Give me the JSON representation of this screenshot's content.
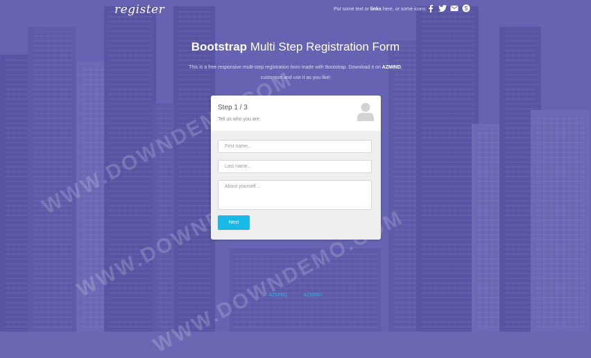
{
  "brand": {
    "logo": "register"
  },
  "topbar": {
    "note_prefix": "Put some text or",
    "note_link": "links",
    "note_suffix": "here, or some icons:",
    "icons": [
      "facebook-icon",
      "twitter-icon",
      "email-icon",
      "skype-icon"
    ]
  },
  "hero": {
    "title_bold": "Bootstrap",
    "title_rest": "Multi Step Registration Form",
    "desc_line1_prefix": "This is a free responsive multi-step registration form made with Bootstrap. Download it on",
    "desc_brand": "AZMIND",
    "desc_line2": "customize and use it as you like!"
  },
  "form": {
    "step": "Step 1 / 3",
    "subtitle": "Tell us who you are:",
    "first_name_placeholder": "First name...",
    "last_name_placeholder": "Last name...",
    "about_placeholder": "About yourself...",
    "next_label": "Next"
  },
  "footer": {
    "link1": "AZMIND",
    "link2": "AZMIND"
  },
  "watermark": {
    "text": "WWW.DOWNDEMO.COM"
  },
  "colors": {
    "accent": "#19b9e7",
    "background": "#6b68b3"
  }
}
